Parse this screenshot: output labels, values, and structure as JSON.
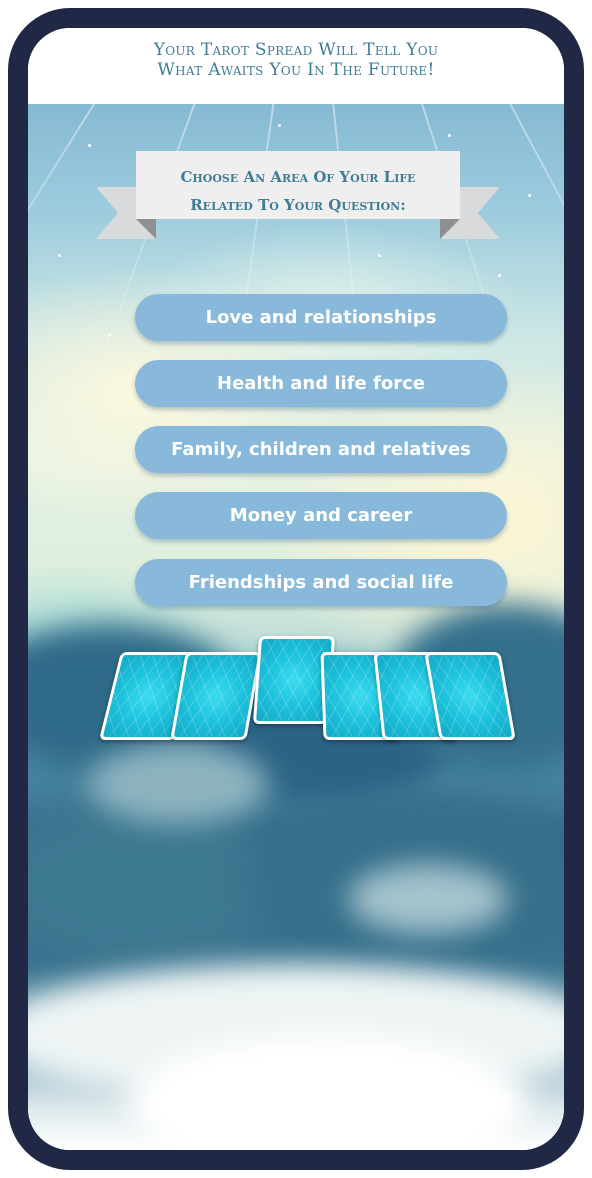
{
  "header": {
    "line1": "Your Tarot Spread Will Tell You",
    "line2": "What Awaits You In The Future!"
  },
  "ribbon": {
    "line1": "Choose An Area Of Your Life",
    "line2": "Related To Your Question:"
  },
  "areas": [
    {
      "label": "Love and relationships"
    },
    {
      "label": "Health and life force"
    },
    {
      "label": "Family, children and relatives"
    },
    {
      "label": "Money and career"
    },
    {
      "label": "Friendships and social life"
    }
  ],
  "colors": {
    "frame": "#212845",
    "heading_text": "#3f7c96",
    "button_bg": "#88b9da",
    "button_text": "#ffffff",
    "card": "#1ec4de"
  },
  "icons": [
    "tarot-card-back-icon"
  ]
}
